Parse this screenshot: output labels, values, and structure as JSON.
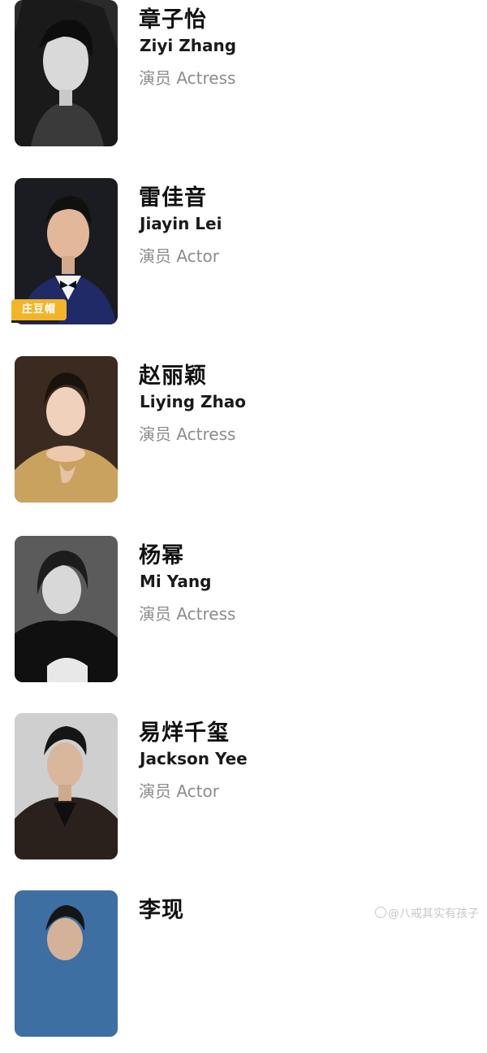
{
  "cast": [
    {
      "name_cn": "章子怡",
      "name_en": "Ziyi Zhang",
      "role": "演员 Actress",
      "photo": "portrait-photo",
      "badge": ""
    },
    {
      "name_cn": "雷佳音",
      "name_en": "Jiayin Lei",
      "role": "演员 Actor",
      "photo": "portrait-photo",
      "badge": "庄豆帽"
    },
    {
      "name_cn": "赵丽颖",
      "name_en": "Liying Zhao",
      "role": "演员 Actress",
      "photo": "portrait-photo",
      "badge": ""
    },
    {
      "name_cn": "杨幂",
      "name_en": "Mi Yang",
      "role": "演员 Actress",
      "photo": "portrait-photo",
      "badge": ""
    },
    {
      "name_cn": "易烊千玺",
      "name_en": "Jackson Yee",
      "role": "演员 Actor",
      "photo": "portrait-photo",
      "badge": ""
    },
    {
      "name_cn": "李现",
      "name_en": "",
      "role": "",
      "photo": "portrait-photo",
      "badge": ""
    }
  ],
  "watermark": {
    "text": "@八戒其实有孩子",
    "icon": "platform-logo-icon"
  },
  "colors": {
    "background": "#ffffff",
    "name": "#111111",
    "role": "#8c8c8c",
    "badge": "#f2b42a"
  }
}
